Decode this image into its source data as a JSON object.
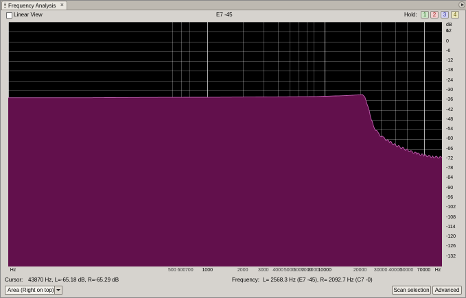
{
  "panel": {
    "tab_label": "Frequency Analysis",
    "close_glyph": "×",
    "menu_icon": "panel-menu-icon"
  },
  "controls": {
    "linear_view_label": "Linear View",
    "linear_view_checked": false,
    "note_readout": "E7 -45",
    "hold_label": "Hold:",
    "hold_buttons": [
      "1",
      "2",
      "3",
      "4"
    ]
  },
  "chart_data": {
    "type": "area",
    "x_scale": "log",
    "xlim": [
      20,
      100000
    ],
    "ylim": [
      -138,
      12
    ],
    "y_unit": "dB",
    "x_unit": "Hz",
    "y_ticks": [
      12,
      6,
      0,
      -6,
      -12,
      -18,
      -24,
      -30,
      -36,
      -42,
      -48,
      -54,
      -60,
      -66,
      -72,
      -78,
      -84,
      -90,
      -96,
      -102,
      -108,
      -114,
      -120,
      -126,
      -132
    ],
    "x_tick_labels": [
      {
        "hz": 20,
        "label": "Hz",
        "major": true
      },
      {
        "hz": 500,
        "label": "500",
        "major": false
      },
      {
        "hz": 600,
        "label": "600",
        "major": false
      },
      {
        "hz": 700,
        "label": "700",
        "major": false
      },
      {
        "hz": 1000,
        "label": "1000",
        "major": true
      },
      {
        "hz": 2000,
        "label": "2000",
        "major": false
      },
      {
        "hz": 3000,
        "label": "3000",
        "major": false
      },
      {
        "hz": 4000,
        "label": "4000",
        "major": false
      },
      {
        "hz": 5000,
        "label": "5000",
        "major": false
      },
      {
        "hz": 6000,
        "label": "6000",
        "major": false
      },
      {
        "hz": 7000,
        "label": "7000",
        "major": false
      },
      {
        "hz": 8000,
        "label": "8000",
        "major": false
      },
      {
        "hz": 10000,
        "label": "10000",
        "major": true
      },
      {
        "hz": 20000,
        "label": "20000",
        "major": false
      },
      {
        "hz": 30000,
        "label": "30000",
        "major": false
      },
      {
        "hz": 40000,
        "label": "40000",
        "major": false
      },
      {
        "hz": 50000,
        "label": "50000",
        "major": false
      },
      {
        "hz": 70000,
        "label": "70000",
        "major": true
      },
      {
        "hz": 100000,
        "label": "Hz",
        "major": true
      }
    ],
    "series": [
      {
        "fill_color": "#62104c",
        "line_color": "#c060b0",
        "points": [
          [
            20,
            -34.5
          ],
          [
            100,
            -34.5
          ],
          [
            300,
            -34.3
          ],
          [
            1000,
            -34.2
          ],
          [
            3000,
            -34.0
          ],
          [
            8000,
            -33.8
          ],
          [
            15000,
            -33.2
          ],
          [
            21000,
            -32.6
          ],
          [
            22000,
            -34
          ],
          [
            24000,
            -43
          ],
          [
            26000,
            -52
          ],
          [
            29000,
            -57
          ],
          [
            33000,
            -60
          ],
          [
            40000,
            -63.5
          ],
          [
            50000,
            -66.5
          ],
          [
            60000,
            -68.5
          ],
          [
            70000,
            -69.8
          ],
          [
            85000,
            -70.8
          ],
          [
            100000,
            -71.2
          ]
        ]
      }
    ],
    "grid": true,
    "grid_color": "#ffffff"
  },
  "status": {
    "cursor_label": "Cursor:",
    "cursor_value": "43870 Hz, L=-65.18 dB, R=-65.29 dB",
    "frequency_label": "Frequency:",
    "frequency_value": "L= 2568.3 Hz (E7 -45), R= 2092.7 Hz (C7 -0)"
  },
  "bottom": {
    "area_select_value": "Area (Right on top)",
    "scan_button": "Scan selection",
    "advanced_button": "Advanced"
  }
}
